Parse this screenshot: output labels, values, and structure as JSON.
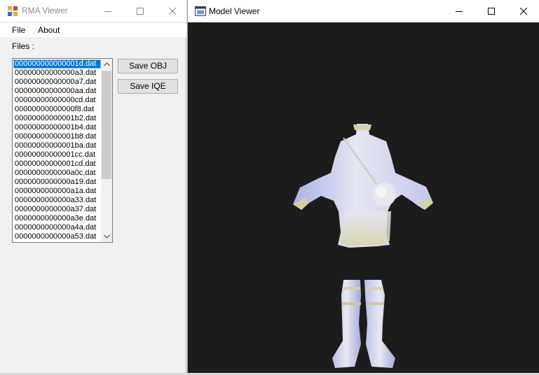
{
  "left_window": {
    "title": "RMA Viewer",
    "icons": {
      "app": "app-icon",
      "minimize": "minimize-icon",
      "maximize": "maximize-icon",
      "close": "close-icon"
    },
    "menu": [
      "File",
      "About"
    ],
    "files_label": "Files :",
    "files": [
      "000000000000001d.dat",
      "00000000000000a3.dat",
      "00000000000000a7.dat",
      "00000000000000aa.dat",
      "00000000000000cd.dat",
      "00000000000000f8.dat",
      "00000000000001b2.dat",
      "00000000000001b4.dat",
      "00000000000001b8.dat",
      "00000000000001ba.dat",
      "00000000000001cc.dat",
      "00000000000001cd.dat",
      "0000000000000a0c.dat",
      "0000000000000a19.dat",
      "0000000000000a1a.dat",
      "0000000000000a33.dat",
      "0000000000000a37.dat",
      "0000000000000a3e.dat",
      "0000000000000a4a.dat",
      "0000000000000a53.dat"
    ],
    "selected_index": 0,
    "buttons": {
      "save_obj": "Save OBJ",
      "save_iqe": "Save IQE"
    }
  },
  "right_window": {
    "title": "Model Viewer",
    "icons": {
      "app": "window-icon",
      "minimize": "minimize-icon",
      "maximize": "maximize-icon",
      "close": "close-icon"
    },
    "viewport_background": "#1c1c1c",
    "model_color": "#c8d0f0"
  }
}
